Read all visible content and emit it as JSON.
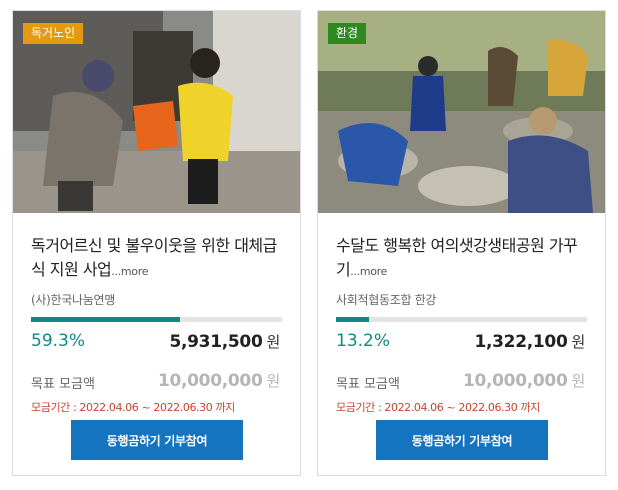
{
  "cards": [
    {
      "badge": "독거노인",
      "badge_color": "#e39a10",
      "title": "독거어르신 및 불우이웃을 위한 대체급식 지원 사업",
      "more": "...more",
      "org": "(사)한국나눔연맹",
      "progress_percent_value": 59.3,
      "percent": "59.3%",
      "raised": "5,931,500",
      "won": "원",
      "goal_label": "목표 모금액",
      "goal": "10,000,000",
      "period": "모금기간 : 2022.04.06 ~ 2022.06.30 까지",
      "button": "동행곰하기 기부참여"
    },
    {
      "badge": "환경",
      "badge_color": "#2c8a1f",
      "title": "수달도 행복한 여의샛강생태공원 가꾸기",
      "more": "...more",
      "org": "사회적협동조합 한강",
      "progress_percent_value": 13.2,
      "percent": "13.2%",
      "raised": "1,322,100",
      "won": "원",
      "goal_label": "목표 모금액",
      "goal": "10,000,000",
      "period": "모금기간 : 2022.04.06 ~ 2022.06.30 까지",
      "button": "동행곰하기 기부참여"
    }
  ]
}
